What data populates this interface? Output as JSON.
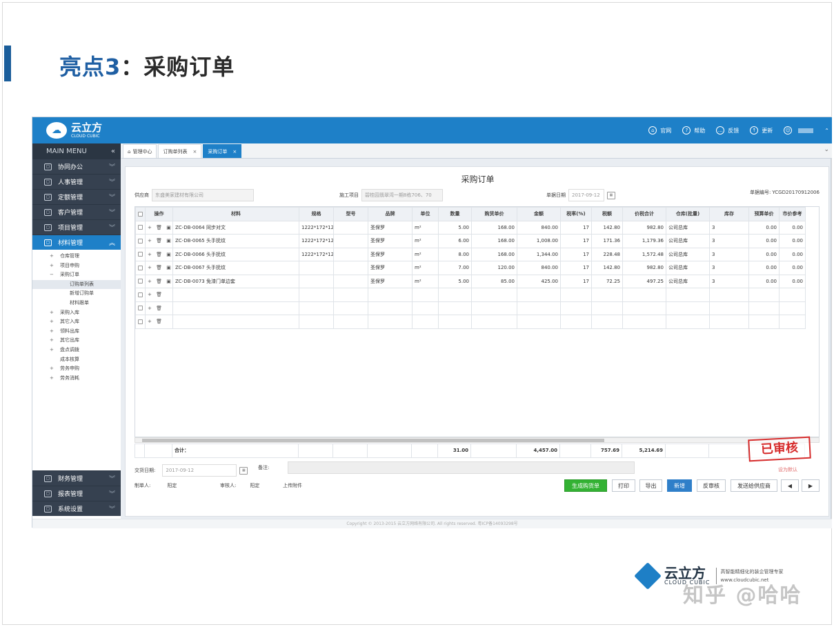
{
  "slide": {
    "title_highlight": "亮点3",
    "title_rest": "：采购订单"
  },
  "app": {
    "logo_cn": "云立方",
    "logo_en": "CLOUD CUBIC"
  },
  "topnav": [
    {
      "label": "官网",
      "icon": "home-icon"
    },
    {
      "label": "帮助",
      "icon": "help-icon"
    },
    {
      "label": "反馈",
      "icon": "feedback-icon"
    },
    {
      "label": "更新",
      "icon": "update-icon"
    }
  ],
  "sidebar": {
    "header": "MAIN MENU",
    "collapse": "«",
    "items": [
      "协同办公",
      "人事管理",
      "定额管理",
      "客户管理",
      "项目管理",
      "材料管理"
    ],
    "active": "材料管理",
    "subtree": [
      {
        "label": "仓库管理",
        "pm": "+",
        "level": 1
      },
      {
        "label": "项目申购",
        "pm": "+",
        "level": 1
      },
      {
        "label": "采购订单",
        "pm": "−",
        "level": 1
      },
      {
        "label": "订购单列表",
        "pm": "",
        "level": 2
      },
      {
        "label": "新增订购单",
        "pm": "",
        "level": 2
      },
      {
        "label": "材料跟单",
        "pm": "",
        "level": 2
      },
      {
        "label": "采购入库",
        "pm": "+",
        "level": 1
      },
      {
        "label": "其它入库",
        "pm": "+",
        "level": 1
      },
      {
        "label": "领料出库",
        "pm": "+",
        "level": 1
      },
      {
        "label": "其它出库",
        "pm": "+",
        "level": 1
      },
      {
        "label": "盘点调拨",
        "pm": "+",
        "level": 1
      },
      {
        "label": "成本核算",
        "pm": "",
        "level": 0
      },
      {
        "label": "劳务申购",
        "pm": "+",
        "level": 1
      },
      {
        "label": "劳务消耗",
        "pm": "+",
        "level": 1
      }
    ],
    "bottom_items": [
      "财务管理",
      "报表管理",
      "系统设置"
    ]
  },
  "tabs": [
    {
      "label": "管理中心",
      "closable": false
    },
    {
      "label": "订购单列表",
      "closable": true
    },
    {
      "label": "采购订单",
      "closable": true,
      "active": true
    }
  ],
  "form": {
    "title": "采购订单",
    "supplier_label": "供应商",
    "supplier_value": "东盛美家建材有限公司",
    "project_label": "施工项目",
    "project_value": "碧桂园翡翠湾一期8栋706、70",
    "date_label": "单据日期",
    "date_value": "2017-09-12",
    "no_label": "单据编号:",
    "no_value": "YCGD20170912006"
  },
  "table": {
    "headers": [
      "操作",
      "材料",
      "规格",
      "型号",
      "品牌",
      "单位",
      "数量",
      "购货单价",
      "金额",
      "税率(%)",
      "税额",
      "价税合计",
      "仓库(批量)",
      "库存",
      "预算单价",
      "市价参考"
    ],
    "rows": [
      [
        "ZC-DB-0064 同步对文",
        "1222*172*12",
        "",
        "圣保罗",
        "m²",
        "5.00",
        "168.00",
        "840.00",
        "17",
        "142.80",
        "982.80",
        "公司总库",
        "3",
        "0.00",
        "0.00"
      ],
      [
        "ZC-DB-0065 头手抚纹",
        "1222*172*12",
        "",
        "圣保罗",
        "m²",
        "6.00",
        "168.00",
        "1,008.00",
        "17",
        "171.36",
        "1,179.36",
        "公司总库",
        "3",
        "0.00",
        "0.00"
      ],
      [
        "ZC-DB-0066 头手抚纹",
        "1222*172*12",
        "",
        "圣保罗",
        "m²",
        "8.00",
        "168.00",
        "1,344.00",
        "17",
        "228.48",
        "1,572.48",
        "公司总库",
        "3",
        "0.00",
        "0.00"
      ],
      [
        "ZC-DB-0067 头手抚纹",
        "",
        "",
        "圣保罗",
        "m²",
        "7.00",
        "120.00",
        "840.00",
        "17",
        "142.80",
        "982.80",
        "公司总库",
        "3",
        "0.00",
        "0.00"
      ],
      [
        "ZC-DB-0073 免漆门单边套",
        "",
        "",
        "圣保罗",
        "m²",
        "5.00",
        "85.00",
        "425.00",
        "17",
        "72.25",
        "497.25",
        "公司总库",
        "3",
        "0.00",
        "0.00"
      ]
    ],
    "empty_rows": 3,
    "filler_rows": 8,
    "totals": {
      "label": "合计：",
      "qty": "31.00",
      "amount": "4,457.00",
      "tax": "757.69",
      "total": "5,214.69"
    }
  },
  "stamp": {
    "text": "已审核",
    "sub": "设为默认"
  },
  "bottom": {
    "delivery_label": "交货日期:",
    "delivery_value": "2017-09-12",
    "remark_label": "备注:",
    "maker_label": "制单人:",
    "maker_value": "阳定",
    "reviewer_label": "审核人:",
    "reviewer_value": "阳定",
    "attach_label": "上传附件"
  },
  "buttons": {
    "generate": "生成购货单",
    "print": "打印",
    "export": "导出",
    "add": "新增",
    "unreview": "反审核",
    "send": "发送给供应商",
    "prev": "◀",
    "next": "▶"
  },
  "copyright": "Copyright © 2013-2015 云立方网络有限公司. All rights reserved. 粤ICP备14093298号",
  "brand": {
    "cn": "云立方",
    "en": "CLOUD CUBIC",
    "tagline": "高智能精细化的装企管理专家",
    "url": "www.cloudcubic.net"
  },
  "watermark": "知乎 @哈哈"
}
